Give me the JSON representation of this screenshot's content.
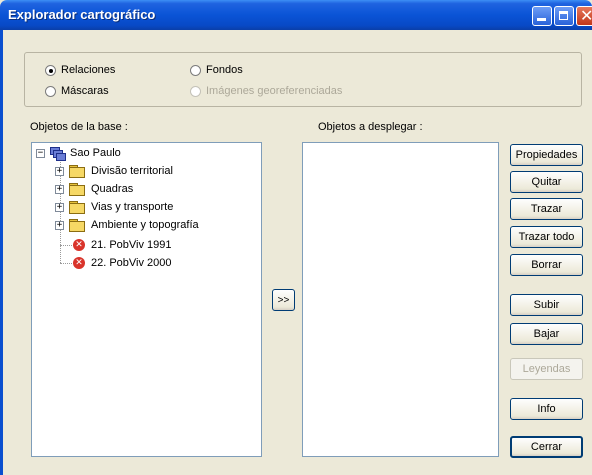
{
  "window": {
    "title": "Explorador cartográfico"
  },
  "options": {
    "relaciones": {
      "label": "Relaciones",
      "checked": true
    },
    "fondos": {
      "label": "Fondos",
      "checked": false
    },
    "mascaras": {
      "label": "Máscaras",
      "checked": false
    },
    "imagenes": {
      "label": "Imágenes georeferenciadas",
      "checked": false,
      "enabled": false
    }
  },
  "left_panel": {
    "label": "Objetos de la base :",
    "tree": {
      "root": {
        "label": "Sao Paulo",
        "icon": "layers-icon",
        "expanded": true
      },
      "children": [
        {
          "label": "Divisão territorial",
          "icon": "folder-icon",
          "expandable": true
        },
        {
          "label": "Quadras",
          "icon": "folder-icon",
          "expandable": true
        },
        {
          "label": "Vias y transporte",
          "icon": "folder-icon",
          "expandable": true
        },
        {
          "label": "Ambiente y topografía",
          "icon": "folder-icon",
          "expandable": true
        },
        {
          "label": "21. PobViv 1991",
          "icon": "error-icon",
          "expandable": false
        },
        {
          "label": "22. PobViv 2000",
          "icon": "error-icon",
          "expandable": false
        }
      ]
    }
  },
  "move_button": {
    "label": ">>"
  },
  "right_panel": {
    "label": "Objetos a desplegar :"
  },
  "buttons": {
    "propiedades": "Propiedades",
    "quitar": "Quitar",
    "trazar": "Trazar",
    "trazar_todo": "Trazar todo",
    "borrar": "Borrar",
    "subir": "Subir",
    "bajar": "Bajar",
    "leyendas": "Leyendas",
    "info": "Info",
    "cerrar": "Cerrar"
  }
}
